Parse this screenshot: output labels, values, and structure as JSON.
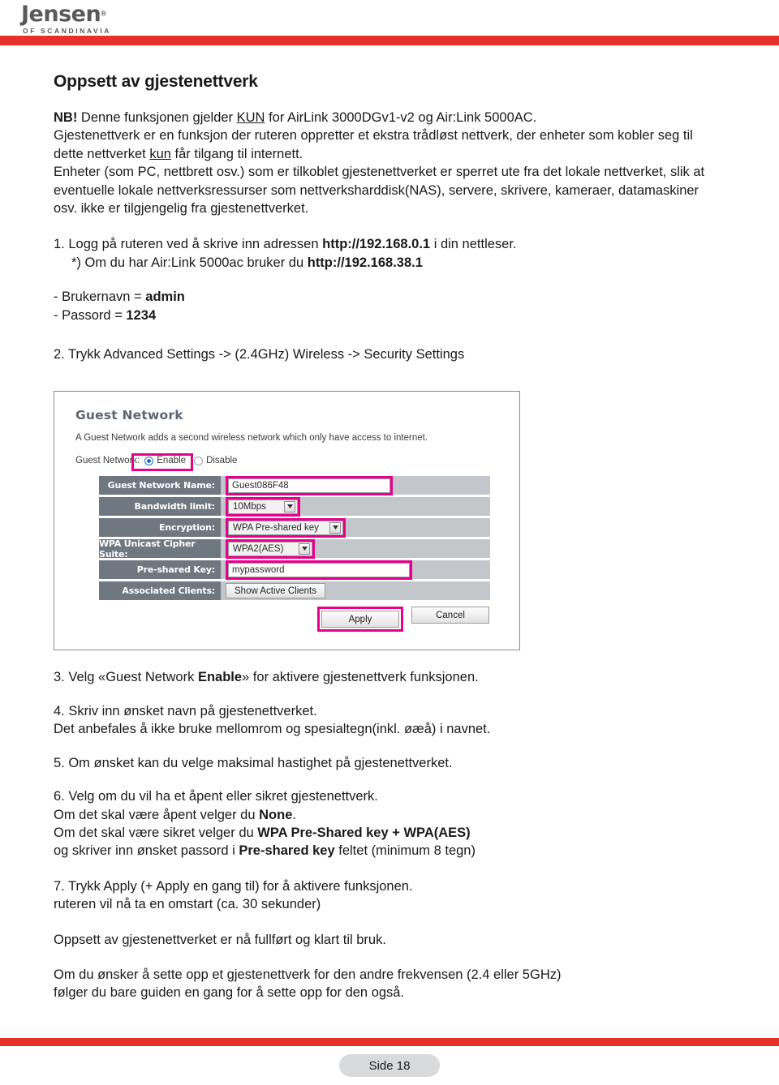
{
  "brand": {
    "logo_word": "Jensen",
    "logo_reg": "®",
    "logo_sub": "OF SCANDINAVIA",
    "accent_red": "#e8302a"
  },
  "page_title": "Oppsett av gjestenettverk",
  "intro": {
    "nb_prefix": "NB!",
    "nb_line": " Denne funksjonen gjelder ",
    "nb_kun": "KUN",
    "nb_rest": " for AirLink 3000DGv1-v2 og Air:Link 5000AC.",
    "p2_a": "Gjestenettverk er en funksjon der ruteren oppretter et ekstra trådløst nettverk, der enheter som kobler seg til dette nettverket ",
    "p2_kun": "kun",
    "p2_b": " får tilgang til internett.",
    "p3": "Enheter (som PC, nettbrett osv.) som er tilkoblet gjestenettverket er sperret ute fra det lokale nettverket, slik at eventuelle lokale nettverksressurser som nettverksharddisk(NAS), servere, skrivere, kameraer, datamaskiner osv. ikke er tilgjengelig fra gjestenettverket."
  },
  "steps_top": {
    "s1_a": "1. Logg på ruteren ved å skrive inn adressen ",
    "s1_url": "http://192.168.0.1",
    "s1_b": " i din nettleser.",
    "s1_note_a": "*) Om du har Air:Link 5000ac bruker du ",
    "s1_note_url": "http://192.168.38.1",
    "username_label": "- Brukernavn = ",
    "username_value": "admin",
    "password_label": "- Passord = ",
    "password_value": "1234",
    "s2": "2. Trykk Advanced Settings -> (2.4GHz) Wireless -> Security Settings"
  },
  "router_panel": {
    "heading": "Guest Network",
    "description": "A Guest Network adds a second wireless network which only have access to internet.",
    "guest_network_label": "Guest Network:",
    "radio_enable": "Enable",
    "radio_disable": "Disable",
    "radio_selected": "Enable",
    "rows": [
      {
        "label": "Guest Network Name:",
        "type": "text",
        "value": "Guest086F48",
        "highlight": true
      },
      {
        "label": "Bandwidth limit:",
        "type": "select",
        "value": "10Mbps",
        "highlight": true
      },
      {
        "label": "Encryption:",
        "type": "select",
        "value": "WPA Pre-shared key",
        "highlight": true
      },
      {
        "label": "WPA Unicast Cipher Suite:",
        "type": "select",
        "value": "WPA2(AES)",
        "highlight": true
      },
      {
        "label": "Pre-shared Key:",
        "type": "text",
        "value": "mypassword",
        "highlight": true
      },
      {
        "label": "Associated Clients:",
        "type": "button",
        "value": "Show Active Clients",
        "highlight": false
      }
    ],
    "apply_label": "Apply",
    "cancel_label": "Cancel",
    "highlight_color": "#e6008c"
  },
  "steps_bottom": {
    "s3_a": "3. Velg «Guest Network ",
    "s3_b": "Enable",
    "s3_c": "» for aktivere gjestenettverk funksjonen.",
    "s4_1": "4. Skriv inn ønsket navn på gjestenettverket.",
    "s4_2": "Det anbefales å ikke bruke mellomrom og spesialtegn(inkl. øæå) i navnet.",
    "s5": "5. Om ønsket kan du velge maksimal hastighet på gjestenettverket.",
    "s6_1": "6. Velg om du vil ha et åpent eller sikret gjestenettverk.",
    "s6_2_a": "Om det skal være åpent velger du ",
    "s6_2_b": "None",
    "s6_2_c": ".",
    "s6_3_a": "Om det skal være sikret velger du ",
    "s6_3_b": "WPA Pre-Shared key + WPA(AES)",
    "s6_4_a": "og skriver inn ønsket passord i ",
    "s6_4_b": "Pre-shared key",
    "s6_4_c": " feltet (minimum 8 tegn)",
    "s7_1": "7. Trykk Apply (+ Apply en gang til) for å aktivere funksjonen.",
    "s7_2": "ruteren vil nå ta en omstart (ca. 30 sekunder)",
    "done": "Oppsett av gjestenettverket er nå fullført og klart til bruk.",
    "other_1": "Om du ønsker å sette opp et gjestenettverk for den andre frekvensen (2.4 eller 5GHz)",
    "other_2": "følger du bare guiden en gang for å sette opp for den også."
  },
  "footer": {
    "page_label": "Side 18"
  }
}
